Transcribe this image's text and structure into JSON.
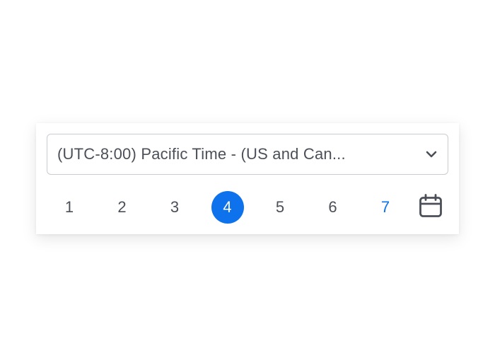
{
  "timezone": {
    "selected": "(UTC-8:00) Pacific Time - (US and Can...",
    "chevron_icon": "chevron-down-icon"
  },
  "days": [
    {
      "label": "1",
      "state": "normal"
    },
    {
      "label": "2",
      "state": "normal"
    },
    {
      "label": "3",
      "state": "normal"
    },
    {
      "label": "4",
      "state": "selected"
    },
    {
      "label": "5",
      "state": "normal"
    },
    {
      "label": "6",
      "state": "normal"
    },
    {
      "label": "7",
      "state": "today"
    }
  ],
  "calendar_button": {
    "icon": "calendar-icon"
  },
  "colors": {
    "accent": "#0e72ed",
    "text": "#4b4f58",
    "border": "#c9ccd1"
  }
}
